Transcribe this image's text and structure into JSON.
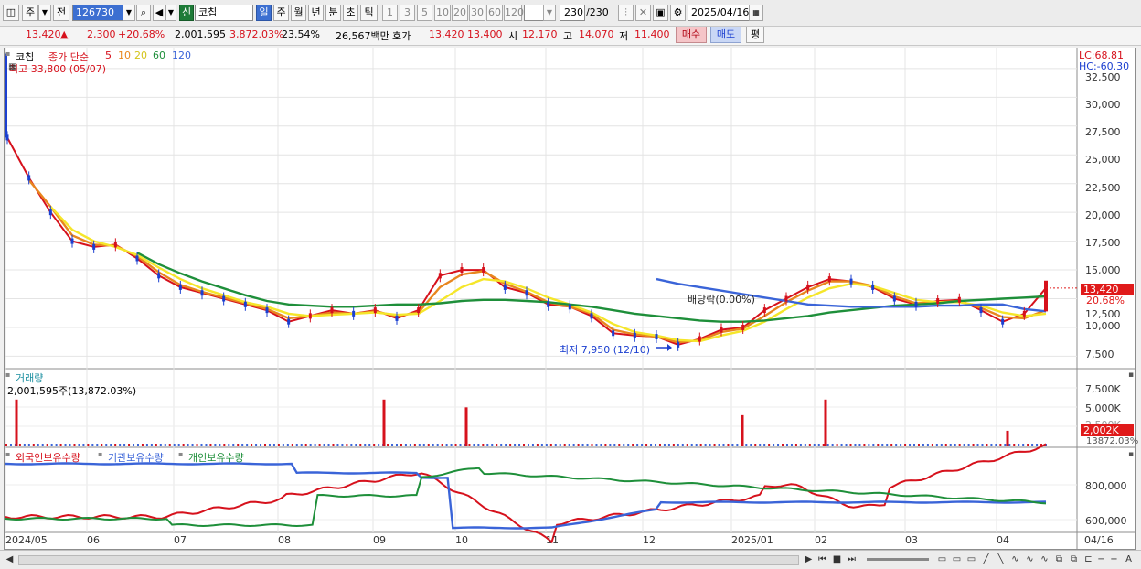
{
  "toolbar": {
    "jong_btn": "주",
    "jeon_btn": "전",
    "code": "126730",
    "sin_badge": "신",
    "name": "코칩",
    "period_buttons": [
      "일",
      "주",
      "월",
      "년",
      "분",
      "초",
      "틱"
    ],
    "selected_period": "일",
    "interval_buttons": [
      "1",
      "3",
      "5",
      "10",
      "20",
      "30",
      "60",
      "120"
    ],
    "count": "230",
    "count_total": "/230",
    "date": "2025/04/16"
  },
  "info": {
    "price": "13,420",
    "arrow": "▲",
    "change": "2,300",
    "change_pct": "+20.68%",
    "volume": "2,001,595",
    "volume_pct": "3,872.03%",
    "turnover": "23.54%",
    "amount": "26,567백만",
    "hoga_label": "호가",
    "hoga_sell": "13,420",
    "hoga_buy": "13,400",
    "open_label": "시",
    "open": "12,170",
    "high_label": "고",
    "high": "14,070",
    "low_label": "저",
    "low": "11,400",
    "buy_btn": "매수",
    "sell_btn": "매도",
    "pyeong_btn": "평"
  },
  "price_pane": {
    "legend_name": "코칩",
    "legend_ma": "종가 단순",
    "ma_periods": [
      "5",
      "10",
      "20",
      "60",
      "120"
    ],
    "ma_colors": [
      "#d6111c",
      "#e8861e",
      "#f5e62a",
      "#1e8f3a",
      "#3a64d8"
    ],
    "high_annotation": "최고 33,800 (05/07)",
    "low_annotation": "최저 7,950 (12/10)",
    "dividend_annotation": "배당락(0.00%)",
    "lc": "LC:68.81",
    "hc": "HC:-60.30",
    "price_tag": "13,420",
    "pct_tag": "20.68%",
    "y_ticks": [
      "32,500",
      "30,000",
      "27,500",
      "25,000",
      "22,500",
      "20,000",
      "17,500",
      "15,000",
      "12,500",
      "10,000",
      "7,500"
    ]
  },
  "volume_pane": {
    "title": "거래량",
    "value": "2,001,595주(13,872.03%)",
    "y_ticks": [
      "7,500K",
      "5,000K",
      "2,500K"
    ],
    "tag": "2,002K",
    "tag2": "13872.03%"
  },
  "holding_pane": {
    "foreign": "외국인보유수량",
    "inst": "기관보유수량",
    "indiv": "개인보유수량",
    "y_ticks": [
      "800,000",
      "600,000"
    ]
  },
  "x_axis": [
    "2024/05",
    "06",
    "07",
    "08",
    "09",
    "10",
    "11",
    "12",
    "2025/01",
    "02",
    "03",
    "04",
    "04/16"
  ],
  "chart_data": {
    "type": "line",
    "title": "코칩",
    "ylabel": "",
    "ylim": [
      6500,
      34000
    ],
    "x_months": [
      "2024/05",
      "06",
      "07",
      "08",
      "09",
      "10",
      "11",
      "12",
      "2025/01",
      "02",
      "03",
      "04"
    ],
    "series": [
      {
        "name": "5",
        "color": "#d6111c",
        "values": [
          26500,
          23000,
          20000,
          17500,
          17000,
          17200,
          16000,
          14500,
          13500,
          13000,
          12500,
          12000,
          11500,
          10500,
          11000,
          11500,
          11200,
          11500,
          10800,
          11500,
          14500,
          15000,
          15000,
          13500,
          13000,
          12000,
          11800,
          11000,
          9500,
          9300,
          9200,
          8500,
          9000,
          9800,
          10000,
          11500,
          12500,
          13500,
          14200,
          14000,
          13500,
          12500,
          12000,
          12300,
          12400,
          11500,
          10500,
          11200,
          13420
        ]
      },
      {
        "name": "10",
        "color": "#e8861e",
        "values": [
          null,
          22800,
          20500,
          18000,
          17200,
          17100,
          16200,
          14800,
          13700,
          13100,
          12600,
          12100,
          11600,
          10800,
          11000,
          11300,
          11200,
          11400,
          11000,
          11300,
          13500,
          14600,
          14900,
          13800,
          13100,
          12200,
          11800,
          11200,
          9800,
          9400,
          9200,
          8700,
          8900,
          9600,
          9900,
          11000,
          12200,
          13200,
          14000,
          14000,
          13600,
          12700,
          12100,
          12200,
          12300,
          11700,
          10900,
          10800,
          11500
        ]
      },
      {
        "name": "20",
        "color": "#f5e62a",
        "values": [
          null,
          null,
          20500,
          18500,
          17500,
          17000,
          16300,
          15200,
          14200,
          13400,
          12800,
          12200,
          11800,
          11200,
          11000,
          11100,
          11200,
          11300,
          11100,
          11200,
          12300,
          13500,
          14200,
          14000,
          13400,
          12600,
          12000,
          11300,
          10300,
          9600,
          9300,
          8900,
          8800,
          9300,
          9700,
          10500,
          11600,
          12600,
          13400,
          13800,
          13600,
          13000,
          12400,
          12200,
          12200,
          11900,
          11300,
          11000,
          11200
        ]
      },
      {
        "name": "60",
        "color": "#1e8f3a",
        "values": [
          null,
          null,
          null,
          null,
          null,
          null,
          16500,
          15500,
          14700,
          14000,
          13400,
          12800,
          12300,
          12000,
          11900,
          11800,
          11800,
          11900,
          12000,
          12000,
          12100,
          12300,
          12400,
          12400,
          12300,
          12200,
          12000,
          11800,
          11500,
          11200,
          11000,
          10800,
          10600,
          10500,
          10500,
          10600,
          10800,
          11000,
          11300,
          11500,
          11700,
          11900,
          12000,
          12100,
          12300,
          12400,
          12500,
          12600,
          12700
        ]
      },
      {
        "name": "120",
        "color": "#3a64d8",
        "values": [
          null,
          null,
          null,
          null,
          null,
          null,
          null,
          null,
          null,
          null,
          null,
          null,
          null,
          null,
          null,
          null,
          null,
          null,
          null,
          null,
          null,
          null,
          null,
          null,
          null,
          null,
          null,
          null,
          null,
          null,
          14200,
          13800,
          13500,
          13200,
          12900,
          12600,
          12300,
          12000,
          11900,
          11800,
          11800,
          11800,
          11800,
          11900,
          11900,
          12000,
          12000,
          11600,
          11400
        ]
      }
    ],
    "volume_spikes": [
      {
        "month": "2024/05",
        "value": 6000
      },
      {
        "month": "09",
        "value": 6000
      },
      {
        "month": "10",
        "value": 5000
      },
      {
        "month": "2025/01",
        "value": 4000
      },
      {
        "month": "02",
        "value": 6000
      },
      {
        "month": "04",
        "value": 2002
      }
    ]
  }
}
